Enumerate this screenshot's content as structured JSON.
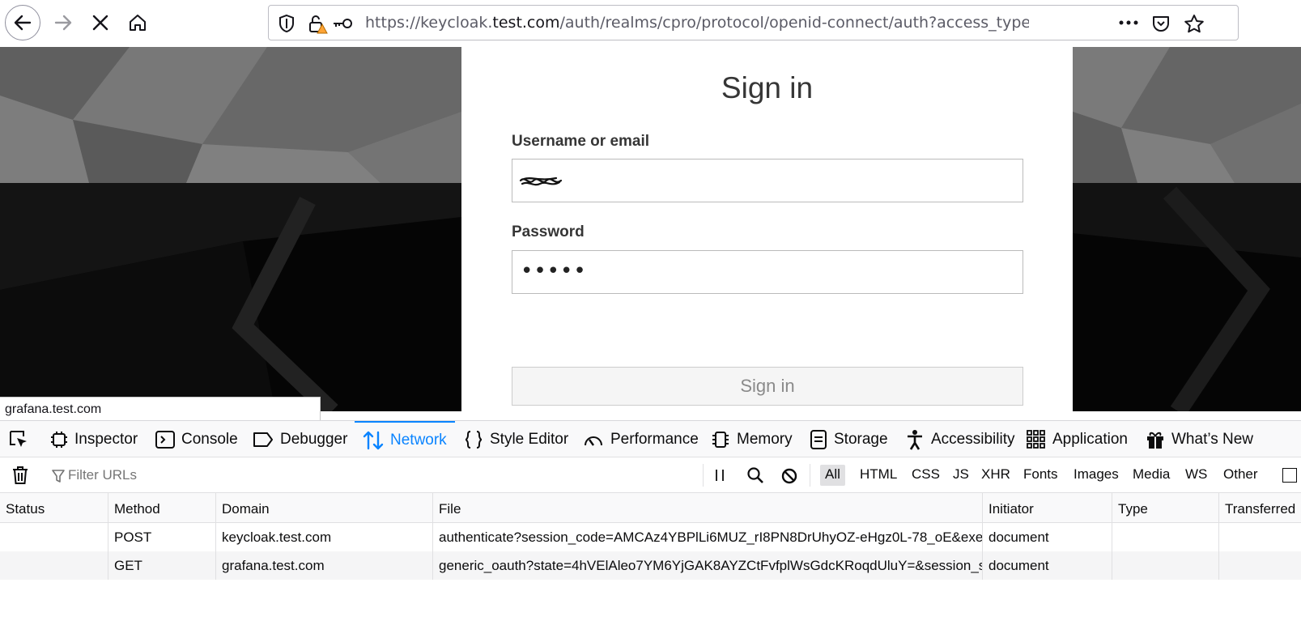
{
  "browser": {
    "url_prefix": "https://keycloak.",
    "url_host": "test.com",
    "url_rest": "/auth/realms/cpro/protocol/openid-connect/auth?access_type=online&client_i"
  },
  "login": {
    "title": "Sign in",
    "username_label": "Username or email",
    "password_label": "Password",
    "password_mask": "•••••",
    "submit_label": "Sign in"
  },
  "status_bar": {
    "link": "grafana.test.com"
  },
  "devtools": {
    "tabs": [
      {
        "label": "Inspector"
      },
      {
        "label": "Console"
      },
      {
        "label": "Debugger"
      },
      {
        "label": "Network"
      },
      {
        "label": "Style Editor"
      },
      {
        "label": "Performance"
      },
      {
        "label": "Memory"
      },
      {
        "label": "Storage"
      },
      {
        "label": "Accessibility"
      },
      {
        "label": "Application"
      },
      {
        "label": "What’s New"
      }
    ],
    "active_tab": "Network",
    "filter_placeholder": "Filter URLs",
    "filter_types": [
      "All",
      "HTML",
      "CSS",
      "JS",
      "XHR",
      "Fonts",
      "Images",
      "Media",
      "WS",
      "Other"
    ],
    "selected_filter": "All",
    "columns": [
      "Status",
      "Method",
      "Domain",
      "File",
      "Initiator",
      "Type",
      "Transferred"
    ],
    "rows": [
      {
        "status": "",
        "method": "POST",
        "domain": "keycloak.test.com",
        "file": "authenticate?session_code=AMCAz4YBPlLi6MUZ_rI8PN8DrUhyOZ-eHgz0L-78_oE&execution",
        "initiator": "document",
        "type": "",
        "transferred": ""
      },
      {
        "status": "",
        "method": "GET",
        "domain": "grafana.test.com",
        "file": "generic_oauth?state=4hVElAleo7YM6YjGAK8AYZCtFvfplWsGdcKRoqdUluY=&session_state=",
        "initiator": "document",
        "type": "",
        "transferred": ""
      }
    ]
  }
}
